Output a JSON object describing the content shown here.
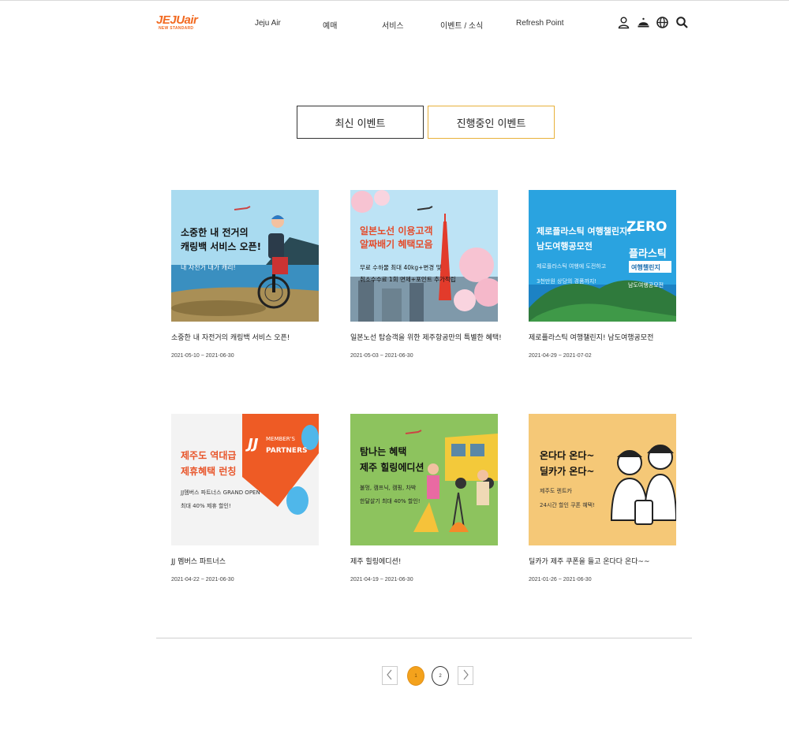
{
  "brand": {
    "logo_main": "JEJUair",
    "logo_sub": "NEW STANDARD",
    "accent_color": "#f26a21"
  },
  "nav": {
    "items": [
      "Jeju Air",
      "예매",
      "서비스",
      "이벤트 / 소식",
      "Refresh Point"
    ],
    "icons": [
      "user-icon",
      "service-bell-icon",
      "globe-icon",
      "search-icon"
    ]
  },
  "tabs": {
    "latest": "최신 이벤트",
    "ongoing": "진행중인 이벤트",
    "active_border_color": "#e8b13a"
  },
  "events": [
    {
      "title": "소중한 내 자전거의 캐링백 서비스 오픈!",
      "date": "2021-05-10 ~ 2021-06-30",
      "banner_lines": [
        "소중한 내 전거의",
        "캐링백 서비스 오픈!",
        "내 자전거 내가 캐리!"
      ]
    },
    {
      "title": "일본노선 탑승객을 위한 제주항공만의 특별한 혜택!",
      "date": "2021-05-03 ~ 2021-06-30",
      "banner_lines": [
        "일본노선 이용고객",
        "알짜배기 혜택모음",
        "무료 수하물 최대 40kg+변경 및",
        "취소수수료 1회 면제+포인트 추가적립"
      ]
    },
    {
      "title": "제로플라스틱 여행챌린지! 남도여행공모전",
      "date": "2021-04-29 ~ 2021-07-02",
      "banner_lines": [
        "제로플라스틱 여행챌린지!",
        "남도여행공모전",
        "제로플라스틱 여행에 도전하고",
        "3천만원 상당의 경품까지!",
        "ZERO",
        "플라스틱",
        "여행챌린지",
        "남도여행공모전"
      ]
    },
    {
      "title": "JJ 멤버스 파트너스",
      "date": "2021-04-22 ~ 2021-06-30",
      "banner_lines": [
        "제주도 역대급",
        "제휴혜택 런칭",
        "JJ멤버스 파트너스 GRAND OPEN",
        "최대 40% 제휴 할인!",
        "MEMBER'S",
        "PARTNERS"
      ]
    },
    {
      "title": "제주 힐링에디션!",
      "date": "2021-04-19 ~ 2021-06-30",
      "banner_lines": [
        "탐나는 혜택",
        "제주 힐링에디션",
        "불멍, 캠프닉, 캠핑, 차박",
        "한달살기 최대 40% 할인!"
      ]
    },
    {
      "title": "딜카가 제주 쿠폰을 들고 온다다 온다~~",
      "date": "2021-01-26 ~ 2021-06-30",
      "banner_lines": [
        "온다다 온다~",
        "딜카가 온다~",
        "제주도 렌트카",
        "24시간 할인 쿠폰 혜택!"
      ]
    }
  ],
  "pagination": {
    "pages": [
      "1",
      "2"
    ],
    "current": "1",
    "active_color": "#f4a21c"
  }
}
